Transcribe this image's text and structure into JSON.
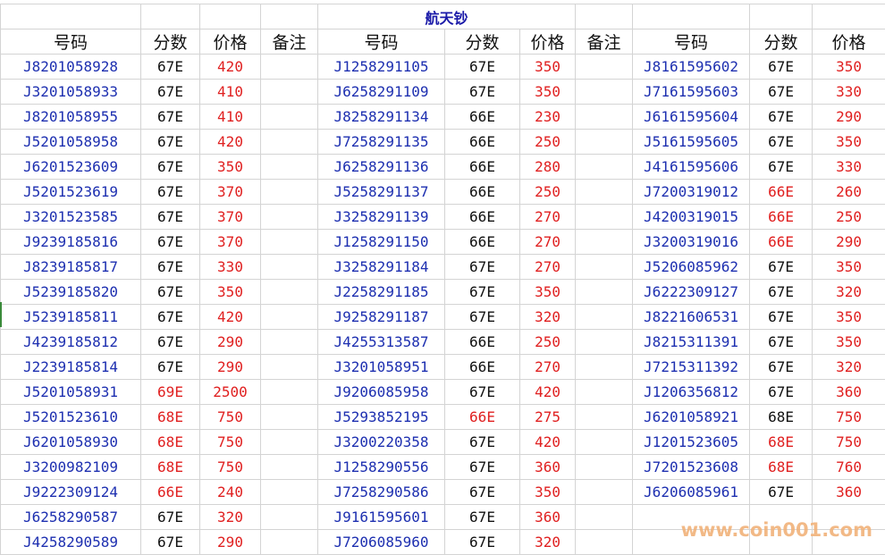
{
  "title": "航天钞",
  "headers": [
    "号码",
    "分数",
    "价格",
    "备注",
    "号码",
    "分数",
    "价格",
    "备注",
    "号码",
    "分数",
    "价格"
  ],
  "colors": {
    "code": "#1d2fb0",
    "red": "#e02020",
    "black": "#111111",
    "grid": "#d4d4d4",
    "title": "#1a1aa8"
  },
  "rows": [
    [
      [
        "J8201058928",
        "67E",
        false,
        "420"
      ],
      [
        "J1258291105",
        "67E",
        false,
        "350"
      ],
      [
        "J8161595602",
        "67E",
        false,
        "350"
      ]
    ],
    [
      [
        "J3201058933",
        "67E",
        false,
        "410"
      ],
      [
        "J6258291109",
        "67E",
        false,
        "350"
      ],
      [
        "J7161595603",
        "67E",
        false,
        "330"
      ]
    ],
    [
      [
        "J8201058955",
        "67E",
        false,
        "410"
      ],
      [
        "J8258291134",
        "66E",
        false,
        "230"
      ],
      [
        "J6161595604",
        "67E",
        false,
        "290"
      ]
    ],
    [
      [
        "J5201058958",
        "67E",
        false,
        "420"
      ],
      [
        "J7258291135",
        "66E",
        false,
        "250"
      ],
      [
        "J5161595605",
        "67E",
        false,
        "350"
      ]
    ],
    [
      [
        "J6201523609",
        "67E",
        false,
        "350"
      ],
      [
        "J6258291136",
        "66E",
        false,
        "280"
      ],
      [
        "J4161595606",
        "67E",
        false,
        "330"
      ]
    ],
    [
      [
        "J5201523619",
        "67E",
        false,
        "370"
      ],
      [
        "J5258291137",
        "66E",
        false,
        "250"
      ],
      [
        "J7200319012",
        "66E",
        true,
        "260"
      ]
    ],
    [
      [
        "J3201523585",
        "67E",
        false,
        "370"
      ],
      [
        "J3258291139",
        "66E",
        false,
        "270"
      ],
      [
        "J4200319015",
        "66E",
        true,
        "250"
      ]
    ],
    [
      [
        "J9239185816",
        "67E",
        false,
        "370"
      ],
      [
        "J1258291150",
        "66E",
        false,
        "270"
      ],
      [
        "J3200319016",
        "66E",
        true,
        "290"
      ]
    ],
    [
      [
        "J8239185817",
        "67E",
        false,
        "330"
      ],
      [
        "J3258291184",
        "67E",
        false,
        "270"
      ],
      [
        "J5206085962",
        "67E",
        false,
        "350"
      ]
    ],
    [
      [
        "J5239185820",
        "67E",
        false,
        "350"
      ],
      [
        "J2258291185",
        "67E",
        false,
        "350"
      ],
      [
        "J6222309127",
        "67E",
        false,
        "320"
      ]
    ],
    [
      [
        "J5239185811",
        "67E",
        false,
        "420"
      ],
      [
        "J9258291187",
        "67E",
        false,
        "320"
      ],
      [
        "J8221606531",
        "67E",
        false,
        "350"
      ]
    ],
    [
      [
        "J4239185812",
        "67E",
        false,
        "290"
      ],
      [
        "J4255313587",
        "66E",
        false,
        "250"
      ],
      [
        "J8215311391",
        "67E",
        false,
        "350"
      ]
    ],
    [
      [
        "J2239185814",
        "67E",
        false,
        "290"
      ],
      [
        "J3201058951",
        "66E",
        false,
        "270"
      ],
      [
        "J7215311392",
        "67E",
        false,
        "320"
      ]
    ],
    [
      [
        "J5201058931",
        "69E",
        true,
        "2500"
      ],
      [
        "J9206085958",
        "67E",
        false,
        "420"
      ],
      [
        "J1206356812",
        "67E",
        false,
        "360"
      ]
    ],
    [
      [
        "J5201523610",
        "68E",
        true,
        "750"
      ],
      [
        "J5293852195",
        "66E",
        true,
        "275"
      ],
      [
        "J6201058921",
        "68E",
        false,
        "750"
      ]
    ],
    [
      [
        "J6201058930",
        "68E",
        true,
        "750"
      ],
      [
        "J3200220358",
        "67E",
        false,
        "420"
      ],
      [
        "J1201523605",
        "68E",
        true,
        "750"
      ]
    ],
    [
      [
        "J3200982109",
        "68E",
        true,
        "750"
      ],
      [
        "J1258290556",
        "67E",
        false,
        "360"
      ],
      [
        "J7201523608",
        "68E",
        true,
        "760"
      ]
    ],
    [
      [
        "J9222309124",
        "66E",
        true,
        "240"
      ],
      [
        "J7258290586",
        "67E",
        false,
        "350"
      ],
      [
        "J6206085961",
        "67E",
        false,
        "360"
      ]
    ],
    [
      [
        "J6258290587",
        "67E",
        false,
        "320"
      ],
      [
        "J9161595601",
        "67E",
        false,
        "360"
      ],
      null
    ],
    [
      [
        "J4258290589",
        "67E",
        false,
        "290"
      ],
      [
        "J7206085960",
        "67E",
        false,
        "320"
      ],
      null
    ]
  ],
  "watermark": "www.coin001.com"
}
